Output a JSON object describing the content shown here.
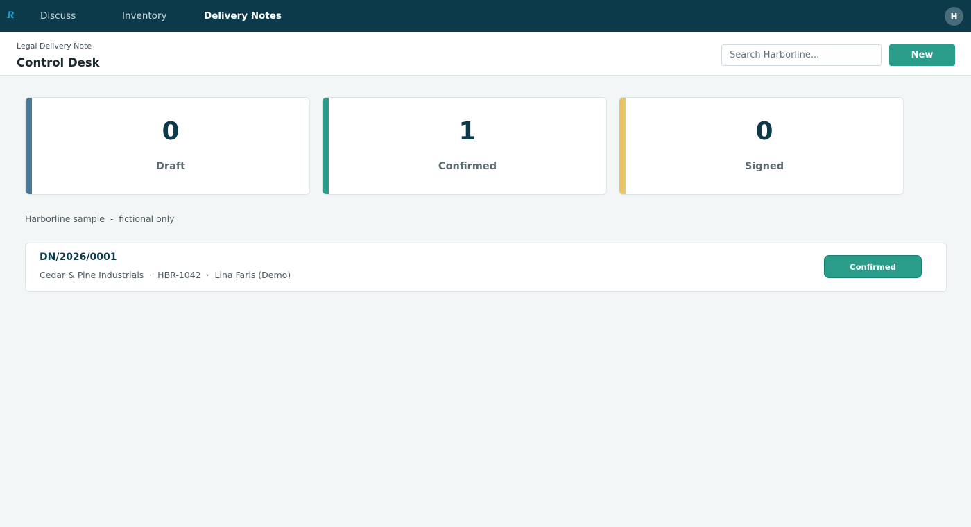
{
  "app": {
    "logo_text": "R",
    "nav": [
      {
        "label": "Discuss",
        "active": false
      },
      {
        "label": "Inventory",
        "active": false
      },
      {
        "label": "Delivery Notes",
        "active": true
      }
    ],
    "user_initial": "H"
  },
  "header": {
    "breadcrumb": "Legal Delivery Note",
    "title": "Control Desk",
    "search_placeholder": "Search Harborline...",
    "new_label": "New"
  },
  "stats": [
    {
      "count": "0",
      "label": "Draft",
      "color": "#4a7898"
    },
    {
      "count": "1",
      "label": "Confirmed",
      "color": "#2a9d8a"
    },
    {
      "count": "0",
      "label": "Signed",
      "color": "#e8c466"
    }
  ],
  "sample_note": "Harborline sample  -  fictional only",
  "delivery_notes": [
    {
      "reference": "DN/2026/0001",
      "meta": "Cedar & Pine Industrials  ·  HBR-1042  ·  Lina Faris (Demo)",
      "status": "Confirmed"
    }
  ],
  "colors": {
    "topbar": "#0d3a4a",
    "accent": "#2a9d8a",
    "background": "#f2f6f7"
  }
}
